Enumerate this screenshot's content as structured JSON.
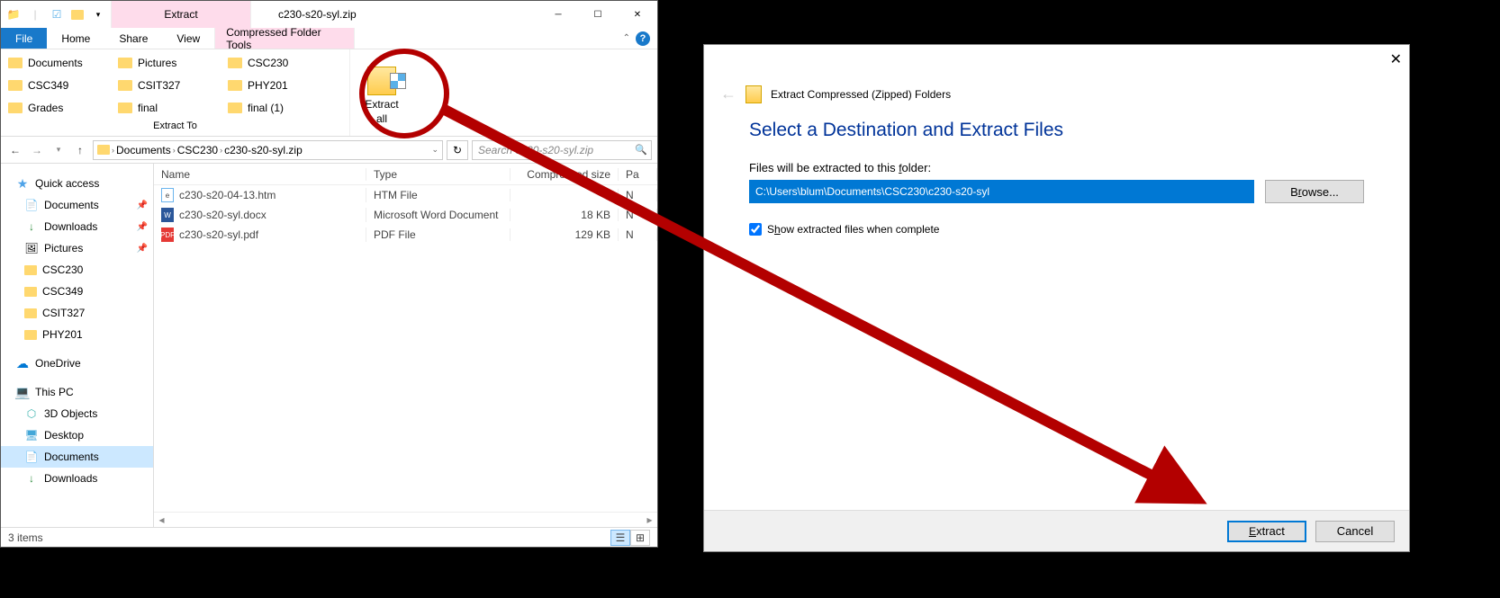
{
  "explorer": {
    "title_tab": "Extract",
    "title_file": "c230-s20-syl.zip",
    "menu": {
      "file": "File",
      "home": "Home",
      "share": "Share",
      "view": "View",
      "tools": "Compressed Folder Tools"
    },
    "ribbon": {
      "destinations": [
        "Documents",
        "Pictures",
        "CSC230",
        "CSC349",
        "CSIT327",
        "PHY201",
        "Grades",
        "final",
        "final (1)"
      ],
      "extract_to_label": "Extract To",
      "extract_all_line1": "Extract",
      "extract_all_line2": "all"
    },
    "breadcrumb": [
      "Documents",
      "CSC230",
      "c230-s20-syl.zip"
    ],
    "search_placeholder": "Search c230-s20-syl.zip",
    "nav": {
      "quick_access": "Quick access",
      "documents": "Documents",
      "downloads": "Downloads",
      "pictures": "Pictures",
      "csc230": "CSC230",
      "csc349": "CSC349",
      "csit327": "CSIT327",
      "phy201": "PHY201",
      "onedrive": "OneDrive",
      "thispc": "This PC",
      "objects3d": "3D Objects",
      "desktop": "Desktop",
      "documents2": "Documents",
      "downloads2": "Downloads"
    },
    "columns": {
      "name": "Name",
      "type": "Type",
      "size": "Compressed size",
      "date": "Pa"
    },
    "files": [
      {
        "name": "c230-s20-04-13.htm",
        "type": "HTM File",
        "size": "1",
        "date": "N",
        "icon": "htm"
      },
      {
        "name": "c230-s20-syl.docx",
        "type": "Microsoft Word Document",
        "size": "18 KB",
        "date": "N",
        "icon": "word"
      },
      {
        "name": "c230-s20-syl.pdf",
        "type": "PDF File",
        "size": "129 KB",
        "date": "N",
        "icon": "pdf"
      }
    ],
    "status": "3 items"
  },
  "dialog": {
    "title": "Extract Compressed (Zipped) Folders",
    "heading": "Select a Destination and Extract Files",
    "path_label": "Files will be extracted to this folder:",
    "path_value": "C:\\Users\\blum\\Documents\\CSC230\\c230-s20-syl",
    "browse": "Browse...",
    "show_checkbox": "Show extracted files when complete",
    "extract_btn": "Extract",
    "cancel_btn": "Cancel"
  }
}
